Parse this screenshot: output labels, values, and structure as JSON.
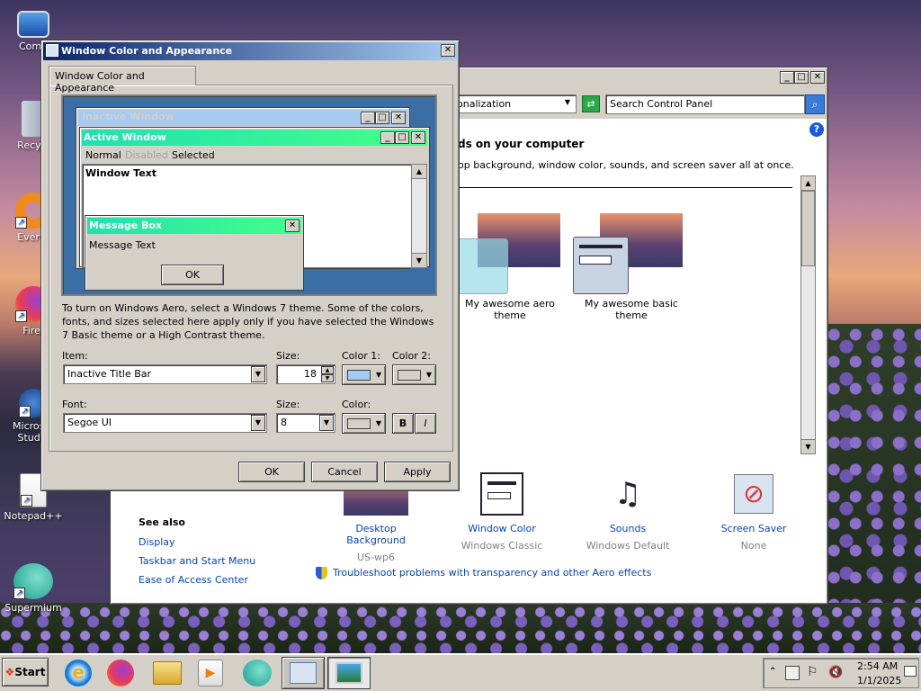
{
  "desktop": {
    "icons": [
      {
        "label": "Comp"
      },
      {
        "label": "Recycl"
      },
      {
        "label": "Everyt"
      },
      {
        "label": "Firef"
      },
      {
        "label": "Microsof Studio"
      },
      {
        "label": "Notepad++"
      },
      {
        "label": "Supermium"
      }
    ]
  },
  "cp": {
    "breadcrumb": "onalization",
    "search_placeholder": "Search Control Panel",
    "heading": "ds on your computer",
    "subheading": "op background, window color, sounds, and screen saver all at once.",
    "themes": [
      {
        "label": "My awesome aero theme"
      },
      {
        "label": "My awesome basic theme"
      }
    ],
    "settings": [
      {
        "label": "Desktop Background",
        "value": "US-wp6"
      },
      {
        "label": "Window Color",
        "value": "Windows Classic"
      },
      {
        "label": "Sounds",
        "value": "Windows Default"
      },
      {
        "label": "Screen Saver",
        "value": "None"
      }
    ],
    "see_also": {
      "title": "See also",
      "links": [
        "Display",
        "Taskbar and Start Menu",
        "Ease of Access Center"
      ]
    },
    "troubleshoot": "Troubleshoot problems with transparency and other Aero effects"
  },
  "dialog": {
    "title": "Window Color and Appearance",
    "tab": "Window Color and Appearance",
    "preview": {
      "inactive_title": "Inactive Window",
      "active_title": "Active Window",
      "menu": [
        "Normal",
        "Disabled",
        "Selected"
      ],
      "window_text": "Window Text",
      "msgbox_title": "Message Box",
      "msgbox_text": "Message Text",
      "ok": "OK"
    },
    "info": "To turn on Windows Aero, select a Windows 7 theme.  Some of the colors, fonts, and sizes selected here apply only if you have selected the Windows 7 Basic theme or a High Contrast theme.",
    "item_label": "Item:",
    "item_value": "Inactive Title Bar",
    "size_label": "Size:",
    "size_value": "18",
    "color1_label": "Color 1:",
    "color2_label": "Color 2:",
    "font_label": "Font:",
    "font_value": "Segoe UI",
    "font_size_label": "Size:",
    "font_size_value": "8",
    "color_label": "Color:",
    "bold": "B",
    "italic": "I",
    "buttons": {
      "ok": "OK",
      "cancel": "Cancel",
      "apply": "Apply"
    }
  },
  "taskbar": {
    "start": "Start",
    "time": "2:54 AM",
    "date": "1/1/2025"
  },
  "colors": {
    "active_title": "#22e0b0",
    "active_title2": "#44ff88",
    "preview_bg": "#3a6ea5",
    "color1": "#a6caf0"
  }
}
